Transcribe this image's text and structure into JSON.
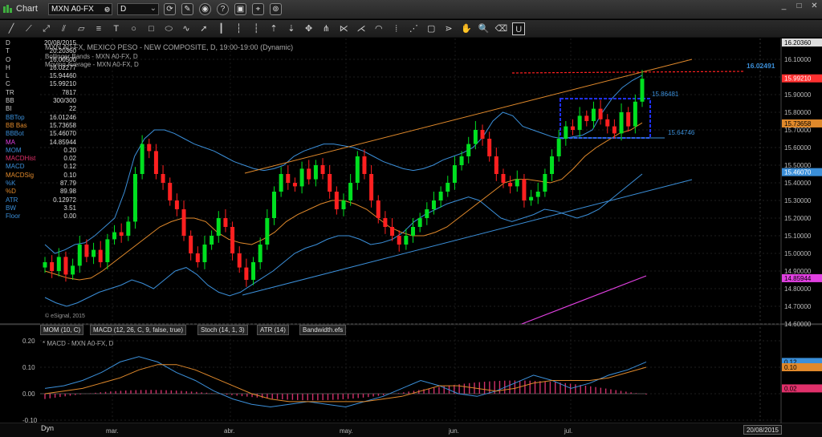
{
  "window": {
    "title": "Chart",
    "symbol": "MXN A0-FX",
    "interval": "D",
    "controls": {
      "minimize": "_",
      "maximize": "□",
      "close": "✕"
    }
  },
  "toolbar_tools": [
    "line",
    "ray",
    "extended-line",
    "parallel",
    "channel",
    "fib",
    "text",
    "circle",
    "rectangle",
    "ellipse",
    "brush",
    "arrow",
    "bars",
    "bars-alt",
    "vertical",
    "cursor-up",
    "cursor-down",
    "cursor-drag",
    "pitchfork",
    "gann",
    "fan",
    "arc",
    "time-zones",
    "speedlines",
    "square",
    "pitch",
    "hand",
    "zoom",
    "eraser",
    "lock"
  ],
  "legend": {
    "title": "MXN A0-FX, MEXICO PESO - NEW COMPOSITE, D, 19:00-19:00 (Dynamic)",
    "line2": "Bollinger Bands - MXN A0-FX, D",
    "line3": "Moving Average - MXN A0-FX, D"
  },
  "data_panel": [
    {
      "k": "D",
      "v": "20/08/2015",
      "color": "#cccccc"
    },
    {
      "k": "T",
      "v": "20:20360",
      "color": "#cccccc"
    },
    {
      "k": "O",
      "v": "16.00500",
      "color": "#cccccc"
    },
    {
      "k": "H",
      "v": "16.02277",
      "color": "#cccccc"
    },
    {
      "k": "L",
      "v": "15.94460",
      "color": "#cccccc"
    },
    {
      "k": "C",
      "v": "15.99210",
      "color": "#cccccc"
    },
    {
      "k": "TR",
      "v": "7817",
      "color": "#cccccc"
    },
    {
      "k": "BB",
      "v": "300/300",
      "color": "#cccccc"
    },
    {
      "k": "BI",
      "v": "22",
      "color": "#cccccc"
    },
    {
      "k": "BBTop",
      "v": "16.01246",
      "color": "#3b8fd9"
    },
    {
      "k": "BB Bas",
      "v": "15.73658",
      "color": "#e0892b"
    },
    {
      "k": "BBBot",
      "v": "15.46070",
      "color": "#3b8fd9"
    },
    {
      "k": "MA",
      "v": "14.85944",
      "color": "#e040e0"
    },
    {
      "k": "MOM",
      "v": "0.20",
      "color": "#3b8fd9"
    },
    {
      "k": "MACDHist",
      "v": "0.02",
      "color": "#e0306a"
    },
    {
      "k": "MACD",
      "v": "0.12",
      "color": "#3b8fd9"
    },
    {
      "k": "MACDSig",
      "v": "0.10",
      "color": "#e0892b"
    },
    {
      "k": "%K",
      "v": "87.79",
      "color": "#3b8fd9"
    },
    {
      "k": "%D",
      "v": "89.98",
      "color": "#e0892b"
    },
    {
      "k": "ATR",
      "v": "0.12972",
      "color": "#3b8fd9"
    },
    {
      "k": "BW",
      "v": "3.51",
      "color": "#3b8fd9"
    },
    {
      "k": "Floor",
      "v": "0.00",
      "color": "#3b8fd9"
    }
  ],
  "price_axis": {
    "labels": [
      "16.10000",
      "16.00000",
      "15.90000",
      "15.80000",
      "15.70000",
      "15.60000",
      "15.50000",
      "15.40000",
      "15.30000",
      "15.20000",
      "15.10000",
      "15.00000",
      "14.90000",
      "14.80000",
      "14.70000",
      "14.60000"
    ],
    "top_label": "16.20360",
    "ylim": [
      14.6,
      16.2
    ]
  },
  "price_markers": [
    {
      "v": 15.9921,
      "label": "15.99210",
      "color": "#ff3030",
      "text_color": "#ffffff"
    },
    {
      "v": 15.73658,
      "label": "15.73658",
      "color": "#e0892b",
      "text_color": "#000000"
    },
    {
      "v": 15.4607,
      "label": "15.46070",
      "color": "#3b8fd9",
      "text_color": "#ffffff"
    },
    {
      "v": 14.85944,
      "label": "14.85944",
      "color": "#e040e0",
      "text_color": "#000000"
    }
  ],
  "annotations": {
    "resistance_label": "16.02491",
    "box_top_label": "15.86481",
    "box_bottom_label": "15.64746"
  },
  "time_axis": {
    "labels": [
      "mar.",
      "abr.",
      "may.",
      "jun.",
      "jul."
    ],
    "date_box": "20/08/2015",
    "dyn_label": "Dyn"
  },
  "copyright": "© eSignal, 2015",
  "indicator_tabs": [
    "MOM (10, C)",
    "MACD (12, 26, C, 9, false, true)",
    "Stoch (14, 1, 3)",
    "ATR (14)",
    "Bandwidth.efs"
  ],
  "macd_pane": {
    "title": "* MACD - MXN A0-FX, D",
    "labels": [
      "0.20",
      "0.10",
      "0.00",
      "-0.10"
    ],
    "ylim": [
      -0.1,
      0.2
    ],
    "markers": [
      {
        "v": 0.12,
        "label": "0.12",
        "color": "#3b8fd9"
      },
      {
        "v": 0.1,
        "label": "0.10",
        "color": "#e0892b"
      },
      {
        "v": 0.02,
        "label": "0.02",
        "color": "#e0306a"
      }
    ]
  },
  "colors": {
    "up": "#00e020",
    "down": "#ff2020",
    "bb_band": "#3b8fd9",
    "bb_basis": "#e0892b",
    "ma": "#e040e0",
    "trend_up": "#e0892b",
    "trend_low": "#3b8fd9",
    "resistance": "#ff2020",
    "box": "#2030ff"
  },
  "chart_data": {
    "type": "candlestick",
    "title": "MXN A0-FX, MEXICO PESO - NEW COMPOSITE, D",
    "ylim": [
      14.6,
      16.2
    ],
    "x_months": [
      "mar.",
      "abr.",
      "may.",
      "jun.",
      "jul."
    ],
    "closes": [
      14.95,
      14.9,
      14.98,
      14.88,
      14.93,
      15.05,
      14.98,
      15.02,
      14.95,
      15.08,
      15.12,
      15.1,
      15.18,
      15.45,
      15.62,
      15.58,
      15.45,
      15.4,
      15.3,
      15.25,
      15.1,
      15.0,
      14.95,
      15.05,
      15.1,
      15.2,
      15.15,
      15.0,
      14.92,
      14.85,
      14.95,
      15.05,
      15.2,
      15.35,
      15.45,
      15.4,
      15.38,
      15.48,
      15.42,
      15.5,
      15.45,
      15.35,
      15.25,
      15.3,
      15.4,
      15.55,
      15.45,
      15.3,
      15.2,
      15.15,
      15.1,
      15.05,
      15.1,
      15.15,
      15.2,
      15.25,
      15.3,
      15.35,
      15.4,
      15.5,
      15.55,
      15.62,
      15.7,
      15.65,
      15.55,
      15.45,
      15.4,
      15.38,
      15.42,
      15.3,
      15.32,
      15.35,
      15.45,
      15.55,
      15.65,
      15.72,
      15.7,
      15.78,
      15.75,
      15.82,
      15.76,
      15.72,
      15.68,
      15.8,
      15.72,
      15.86,
      15.99
    ],
    "bb_top": [
      15.05,
      15.0,
      15.02,
      15.05,
      15.06,
      15.1,
      15.15,
      15.2,
      15.35,
      15.55,
      15.65,
      15.7,
      15.7,
      15.68,
      15.65,
      15.62,
      15.6,
      15.58,
      15.55,
      15.52,
      15.5,
      15.48,
      15.47,
      15.48,
      15.5,
      15.55,
      15.58,
      15.6,
      15.62,
      15.62,
      15.61,
      15.6,
      15.58,
      15.55,
      15.52,
      15.5,
      15.48,
      15.47,
      15.48,
      15.5,
      15.53,
      15.55,
      15.57,
      15.6,
      15.66,
      15.75,
      15.8,
      15.78,
      15.72,
      15.7,
      15.68,
      15.66,
      15.65,
      15.66,
      15.67,
      15.7,
      15.8,
      15.88,
      15.94,
      15.98,
      16.01
    ],
    "bb_bot": [
      14.75,
      14.72,
      14.7,
      14.72,
      14.75,
      14.78,
      14.8,
      14.82,
      14.85,
      14.83,
      14.8,
      14.85,
      14.9,
      14.92,
      14.88,
      14.82,
      14.78,
      14.76,
      14.78,
      14.82,
      14.86,
      14.9,
      14.95,
      15.0,
      15.03,
      15.05,
      15.08,
      15.1,
      15.1,
      15.08,
      15.05,
      15.06,
      15.08,
      15.12,
      15.18,
      15.22,
      15.25,
      15.28,
      15.3,
      15.32,
      15.3,
      15.25,
      15.2,
      15.18,
      15.2,
      15.22,
      15.25,
      15.24,
      15.22,
      15.2,
      15.22,
      15.25,
      15.3,
      15.35,
      15.4,
      15.45
    ],
    "bb_basis": [
      14.9,
      14.88,
      14.86,
      14.85,
      14.86,
      14.9,
      14.95,
      15.0,
      15.05,
      15.1,
      15.15,
      15.18,
      15.2,
      15.2,
      15.18,
      15.12,
      15.08,
      15.06,
      15.05,
      15.08,
      15.12,
      15.18,
      15.22,
      15.25,
      15.28,
      15.3,
      15.3,
      15.28,
      15.25,
      15.2,
      15.15,
      15.12,
      15.1,
      15.1,
      15.12,
      15.15,
      15.2,
      15.25,
      15.3,
      15.35,
      15.4,
      15.42,
      15.42,
      15.41,
      15.4,
      15.42,
      15.48,
      15.55,
      15.6,
      15.64,
      15.68,
      15.7,
      15.74
    ]
  }
}
